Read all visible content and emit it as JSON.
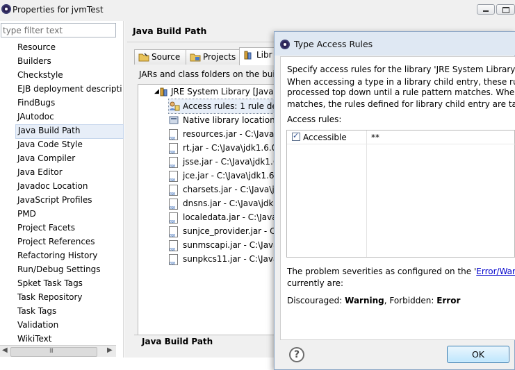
{
  "window": {
    "title": "Properties for jvmTest"
  },
  "sidebar": {
    "filter_placeholder": "type filter text",
    "items": [
      {
        "label": "Resource"
      },
      {
        "label": "Builders"
      },
      {
        "label": "Checkstyle"
      },
      {
        "label": "EJB deployment descripti"
      },
      {
        "label": "FindBugs"
      },
      {
        "label": "JAutodoc"
      },
      {
        "label": "Java Build Path",
        "selected": true
      },
      {
        "label": "Java Code Style"
      },
      {
        "label": "Java Compiler"
      },
      {
        "label": "Java Editor"
      },
      {
        "label": "Javadoc Location"
      },
      {
        "label": "JavaScript Profiles"
      },
      {
        "label": "PMD"
      },
      {
        "label": "Project Facets"
      },
      {
        "label": "Project References"
      },
      {
        "label": "Refactoring History"
      },
      {
        "label": "Run/Debug Settings"
      },
      {
        "label": "Spket Task Tags"
      },
      {
        "label": "Task Repository"
      },
      {
        "label": "Task Tags"
      },
      {
        "label": "Validation"
      },
      {
        "label": "WikiText"
      }
    ]
  },
  "main": {
    "title": "Java Build Path",
    "tabs": [
      {
        "label": "Source",
        "icon": "source-folder-icon"
      },
      {
        "label": "Projects",
        "icon": "projects-icon"
      },
      {
        "label": "Libr",
        "icon": "libraries-icon",
        "active": true
      }
    ],
    "description": "JARs and class folders on the bui",
    "library_tree": {
      "root": "JRE System Library [JavaS",
      "entries": [
        {
          "label": "Access rules: 1 rule de",
          "icon": "access-rules-icon",
          "selected": true
        },
        {
          "label": "Native library location",
          "icon": "native-library-icon"
        },
        {
          "label": "resources.jar - C:\\Java",
          "icon": "jar-icon"
        },
        {
          "label": "rt.jar - C:\\Java\\jdk1.6.0",
          "icon": "jar-icon"
        },
        {
          "label": "jsse.jar - C:\\Java\\jdk1.6",
          "icon": "jar-icon"
        },
        {
          "label": "jce.jar - C:\\Java\\jdk1.6",
          "icon": "jar-icon"
        },
        {
          "label": "charsets.jar - C:\\Java\\j",
          "icon": "jar-icon"
        },
        {
          "label": "dnsns.jar - C:\\Java\\jdk",
          "icon": "jar-icon"
        },
        {
          "label": "localedata.jar - C:\\Java",
          "icon": "jar-icon"
        },
        {
          "label": "sunjce_provider.jar - C",
          "icon": "jar-icon"
        },
        {
          "label": "sunmscapi.jar - C:\\Java",
          "icon": "jar-icon"
        },
        {
          "label": "sunpkcs11.jar - C:\\Java",
          "icon": "jar-icon"
        }
      ]
    },
    "bottom_label": "Java Build Path"
  },
  "dialog": {
    "title": "Type Access Rules",
    "text_line1": "Specify access rules for the library 'JRE System Library [J",
    "text_line2": "When accessing a type in a library child entry, these rules",
    "text_line3": "processed top down until a rule pattern matches. When",
    "text_line4": "matches, the rules defined for library child entry are take",
    "access_rules_label": "Access rules:",
    "rules": [
      {
        "kind": "Accessible",
        "pattern": "**",
        "checked": true
      }
    ],
    "severity_text": "The problem severities as configured on the '",
    "severity_link": "Error/Warn",
    "severity_text2": "currently are:",
    "discouraged_label": "Discouraged: ",
    "discouraged_value": "Warning",
    "forbidden_label": ", Forbidden: ",
    "forbidden_value": "Error",
    "help_glyph": "?",
    "ok_label": "OK"
  },
  "scrollbar": {
    "left_arrow": "◀",
    "right_arrow": "▶",
    "grip": "III"
  }
}
